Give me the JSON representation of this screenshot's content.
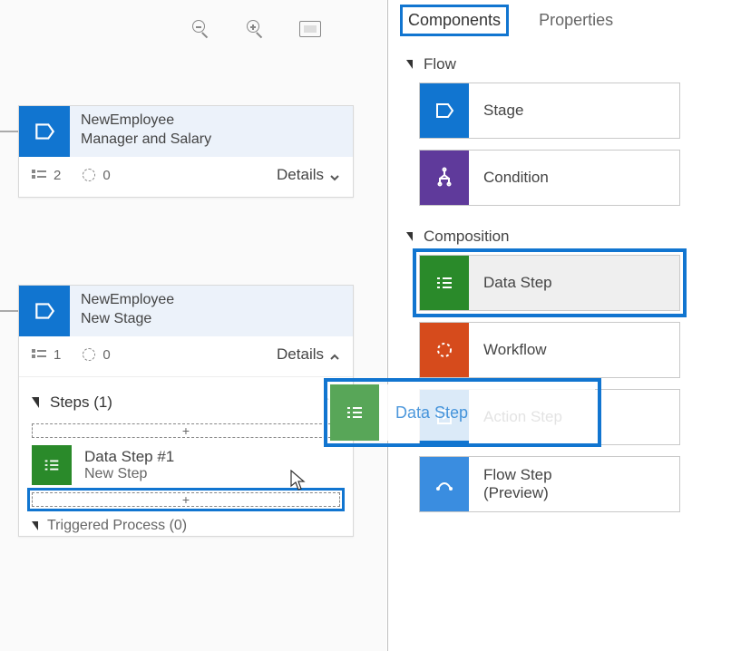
{
  "tabs": {
    "components": "Components",
    "properties": "Properties"
  },
  "sections": {
    "flow": "Flow",
    "composition": "Composition"
  },
  "components": {
    "stage": "Stage",
    "condition": "Condition",
    "data_step": "Data Step",
    "workflow": "Workflow",
    "action_step": "Action Step",
    "flow_step_l1": "Flow Step",
    "flow_step_l2": "(Preview)"
  },
  "canvas": {
    "stage1": {
      "name": "NewEmployee",
      "subtitle": "Manager and Salary",
      "steps_count": "2",
      "triggers_count": "0",
      "details": "Details"
    },
    "stage2": {
      "name": "NewEmployee",
      "subtitle": "New Stage",
      "steps_count": "1",
      "triggers_count": "0",
      "details": "Details",
      "steps_header": "Steps (1)",
      "drop_plus": "+",
      "data_step_title": "Data Step #1",
      "data_step_sub": "New Step",
      "triggered": "Triggered Process (0)"
    }
  },
  "drag_ghost": {
    "label": "Data Step"
  },
  "colors": {
    "blue": "#1175d0",
    "purple": "#5f3a9b",
    "green": "#2a8a2a",
    "orange": "#d64b1c",
    "lblue": "#3a8de0"
  }
}
